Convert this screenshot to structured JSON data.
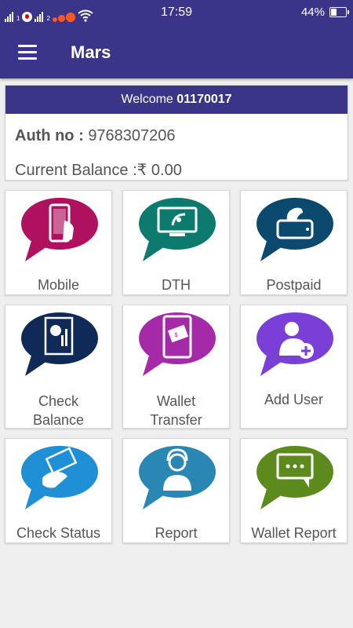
{
  "status_bar": {
    "time": "17:59",
    "battery": "44%",
    "sim1": "1",
    "sim2": "2",
    "icons": [
      "signal-icon",
      "vodafone-icon",
      "signal-icon",
      "cloud-icon",
      "wifi-icon",
      "battery-icon"
    ]
  },
  "app_bar": {
    "title": "Mars",
    "menu_icon": "hamburger-menu-icon"
  },
  "account": {
    "welcome_prefix": "Welcome",
    "user_id": "01170017",
    "auth_label": "Auth no :",
    "auth_value": "9768307206",
    "balance_label": "Current Balance :",
    "balance_value": "₹ 0.00"
  },
  "services": [
    {
      "label": "Mobile",
      "icon": "mobile-recharge-icon",
      "color": "#b0115f"
    },
    {
      "label": "DTH",
      "icon": "dth-dish-icon",
      "color": "#0c7b6d"
    },
    {
      "label": "Postpaid",
      "icon": "postpaid-phone-icon",
      "color": "#0b4a6e"
    },
    {
      "label": "Check\nBalance",
      "line1": "Check",
      "line2": "Balance",
      "icon": "balance-report-icon",
      "color": "#0f2a56"
    },
    {
      "label": "Wallet\nTransfer",
      "line1": "Wallet",
      "line2": "Transfer",
      "icon": "wallet-transfer-icon",
      "color": "#a52aa8"
    },
    {
      "label": "Add User",
      "icon": "add-user-icon",
      "color": "#7a3fd6"
    },
    {
      "label": "Check Status",
      "icon": "check-status-icon",
      "color": "#1f8fd6"
    },
    {
      "label": "Report",
      "icon": "report-support-icon",
      "color": "#2a86b3"
    },
    {
      "label": "Wallet Report",
      "icon": "wallet-report-chat-icon",
      "color": "#5d8a1c"
    }
  ]
}
